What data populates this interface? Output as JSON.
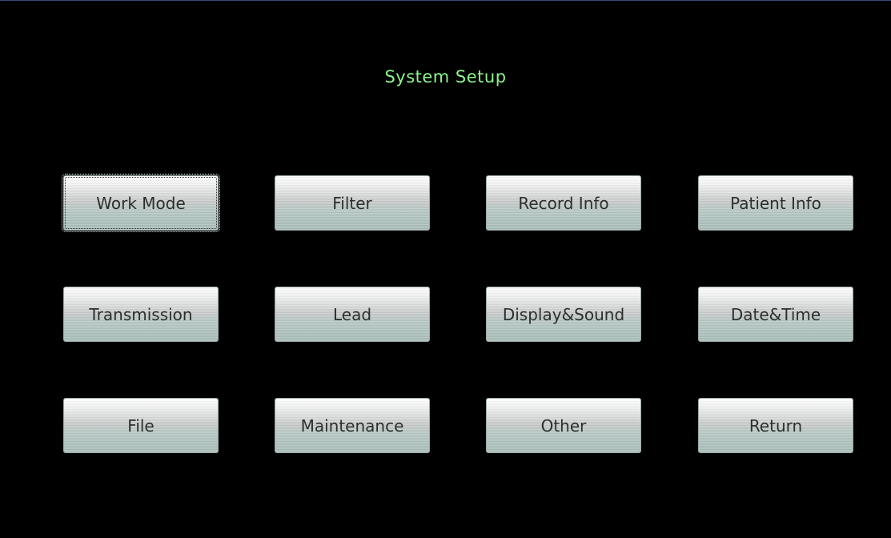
{
  "screen": {
    "title": "System Setup",
    "title_color": "#8cf58c",
    "background_color": "#000000"
  },
  "buttons": {
    "work_mode": "Work Mode",
    "filter": "Filter",
    "record_info": "Record Info",
    "patient_info": "Patient Info",
    "transmission": "Transmission",
    "lead": "Lead",
    "display_sound": "Display&Sound",
    "date_time": "Date&Time",
    "file": "File",
    "maintenance": "Maintenance",
    "other": "Other",
    "return": "Return"
  },
  "focused_button": "Work Mode"
}
